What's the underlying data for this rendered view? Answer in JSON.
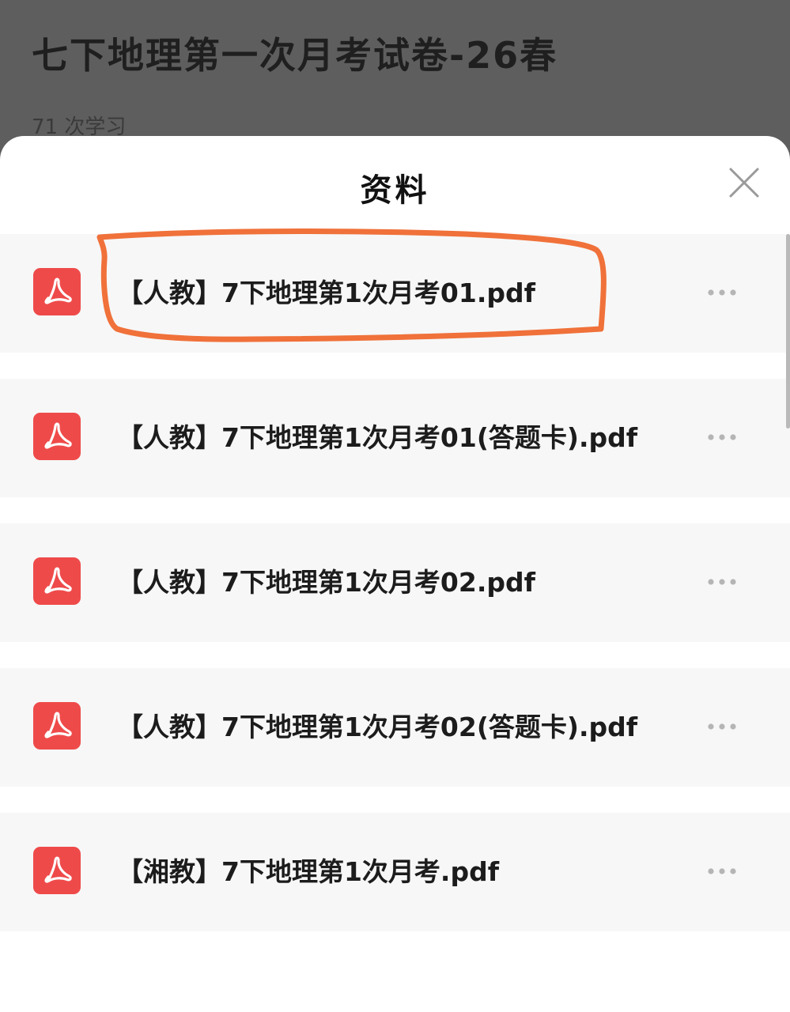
{
  "background": {
    "title": "七下地理第一次月考试卷-26春",
    "study_count": "71 次学习"
  },
  "sheet": {
    "title": "资料",
    "close_icon": "close-icon"
  },
  "files": [
    {
      "name": "【人教】7下地理第1次月考01.pdf",
      "icon": "pdf-icon",
      "more_icon": "more-icon"
    },
    {
      "name": "【人教】7下地理第1次月考01(答题卡).pdf",
      "icon": "pdf-icon",
      "more_icon": "more-icon"
    },
    {
      "name": "【人教】7下地理第1次月考02.pdf",
      "icon": "pdf-icon",
      "more_icon": "more-icon"
    },
    {
      "name": "【人教】7下地理第1次月考02(答题卡).pdf",
      "icon": "pdf-icon",
      "more_icon": "more-icon"
    },
    {
      "name": "【湘教】7下地理第1次月考.pdf",
      "icon": "pdf-icon",
      "more_icon": "more-icon"
    }
  ],
  "colors": {
    "pdf_red": "#ef4a4a",
    "highlight_orange": "#f0713a",
    "row_bg": "#f7f7f7",
    "overlay": "#5e5e5e"
  }
}
